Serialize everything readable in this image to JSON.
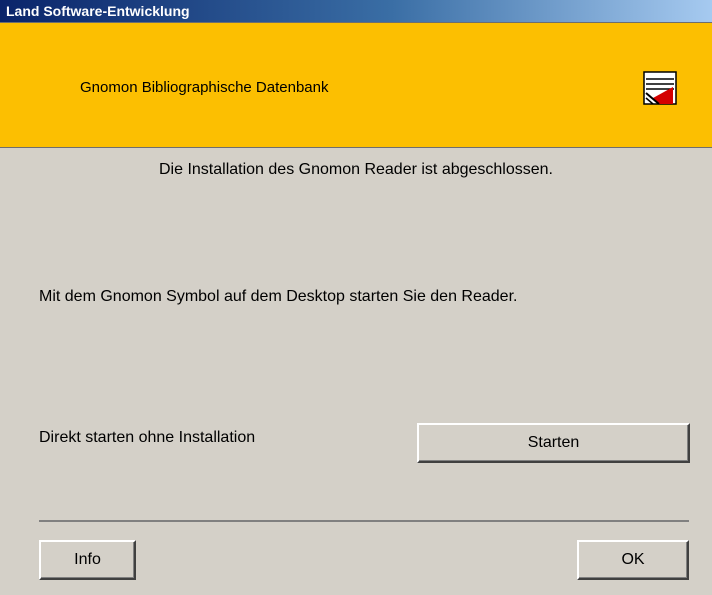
{
  "window": {
    "title": "Land Software-Entwicklung"
  },
  "banner": {
    "title": "Gnomon Bibliographische Datenbank",
    "background": "#fcbf01",
    "logo_icon": "gnomon-logo-icon"
  },
  "messages": {
    "status": "Die Installation des Gnomon Reader ist abgeschlossen.",
    "hint": "Mit dem Gnomon Symbol auf dem Desktop starten Sie den Reader.",
    "direct_start": "Direkt starten ohne Installation"
  },
  "buttons": {
    "start": "Starten",
    "info": "Info",
    "ok": "OK"
  }
}
